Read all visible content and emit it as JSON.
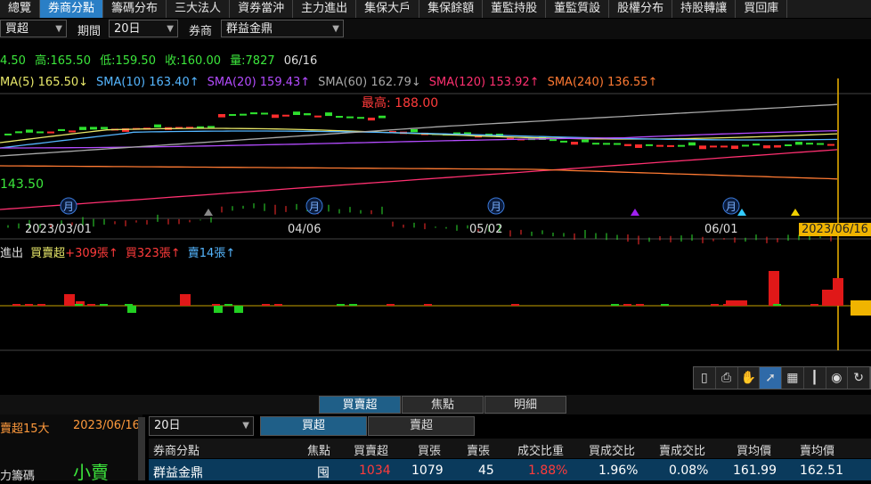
{
  "nav_tabs": [
    "總覽",
    "券商分點",
    "籌碼分布",
    "三大法人",
    "資券當沖",
    "主力進出",
    "集保大戶",
    "集保餘額",
    "董監持股",
    "董監質設",
    "股權分布",
    "持股轉讓",
    "買回庫"
  ],
  "active_tab": "券商分點",
  "controls": {
    "type_value": "買超",
    "period_label": "期間",
    "period_value": "20日",
    "broker_label": "券商",
    "broker_value": "群益金鼎"
  },
  "quote": {
    "open": "4.50",
    "high": "高:165.50",
    "low": "低:159.50",
    "close": "收:160.00",
    "volume": "量:7827",
    "date": "06/16"
  },
  "sma": [
    {
      "label": "MA(5) 165.50↓",
      "color": "#e8e86a"
    },
    {
      "label": "SMA(10) 163.40↑",
      "color": "#55b6ff"
    },
    {
      "label": "SMA(20) 159.43↑",
      "color": "#b44cff"
    },
    {
      "label": "SMA(60) 162.79↓",
      "color": "#a8a8a8"
    },
    {
      "label": "SMA(120) 153.92↑",
      "color": "#ff3070"
    },
    {
      "label": "SMA(240) 136.55↑",
      "color": "#ff7a33"
    }
  ],
  "chart_annotations": {
    "max_label": "最高: 188.00",
    "min_label": "143.50",
    "month_markers": [
      "月",
      "月",
      "月",
      "月"
    ]
  },
  "dates": [
    "2023/03/01",
    "04/06",
    "05/02",
    "06/01",
    "2023/06/16"
  ],
  "volume_legend": {
    "prefix": "進出",
    "series": "買賣超",
    "net": "+309張↑",
    "buy": "買323張↑",
    "sell": "賣14張↑"
  },
  "toolbar": [
    "page-icon",
    "print-icon",
    "hand-icon",
    "cursor-icon",
    "table-icon",
    "bars-icon",
    "eye-icon",
    "refresh-icon"
  ],
  "sub_tabs": [
    "買賣超",
    "焦點",
    "明細"
  ],
  "left_panel": {
    "title": "賣超15大",
    "date": "2023/06/16",
    "label1": "力籌碼",
    "badge": "小賣"
  },
  "table_controls": {
    "period": "20日",
    "tabs": [
      "買超",
      "賣超"
    ]
  },
  "table_headers": [
    "券商分點",
    "焦點",
    "買賣超",
    "買張",
    "賣張",
    "成交比重",
    "買成交比",
    "賣成交比",
    "買均價",
    "賣均價"
  ],
  "rows": [
    [
      "群益金鼎",
      "囤",
      "1034",
      "1079",
      "45",
      "1.88%",
      "1.96%",
      "0.08%",
      "161.99",
      "162.51"
    ]
  ],
  "colors": {
    "up": "#ff2d2d",
    "down": "#2ee02e",
    "accent": "#2a7fc6",
    "marker": "#f0b400"
  }
}
